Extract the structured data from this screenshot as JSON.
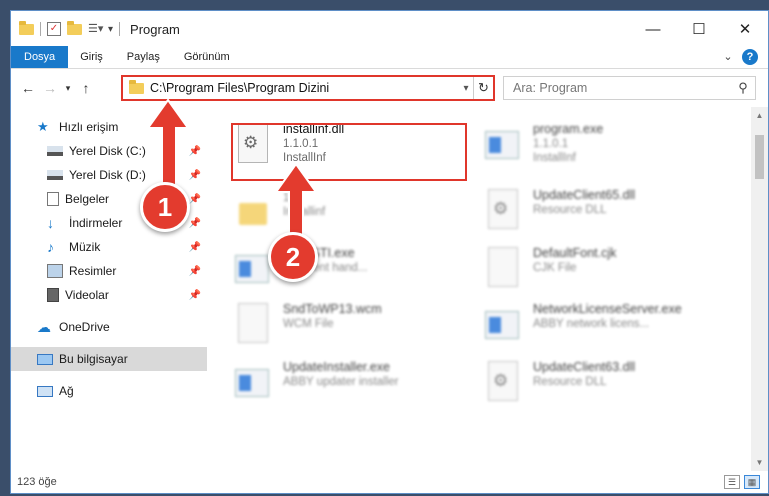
{
  "window": {
    "title": "Program"
  },
  "ribbon": {
    "tabs": [
      "Dosya",
      "Giriş",
      "Paylaş",
      "Görünüm"
    ]
  },
  "address": {
    "path": "C:\\Program Files\\Program Dizini"
  },
  "search": {
    "placeholder": "Ara: Program"
  },
  "sidebar": {
    "quick_access": "Hızlı erişim",
    "pinned": [
      {
        "label": "Yerel Disk (C:)",
        "icon": "drive-icon"
      },
      {
        "label": "Yerel Disk (D:)",
        "icon": "drive-icon"
      },
      {
        "label": "Belgeler",
        "icon": "documents-icon"
      },
      {
        "label": "İndirmeler",
        "icon": "downloads-icon"
      },
      {
        "label": "Müzik",
        "icon": "music-icon"
      },
      {
        "label": "Resimler",
        "icon": "pictures-icon"
      },
      {
        "label": "Videolar",
        "icon": "videos-icon"
      }
    ],
    "onedrive": "OneDrive",
    "this_pc": "Bu bilgisayar",
    "network": "Ağ"
  },
  "files": {
    "left": [
      {
        "name": "installinf.dll",
        "line2": "1.1.0.1",
        "line3": "InstallInf",
        "icon": "dll-icon"
      },
      {
        "name": "",
        "line2": "1.1",
        "line3": "Installinf",
        "icon": "folder-icon"
      },
      {
        "name": "AbbySTI.exe",
        "line2": "...ll event hand...",
        "line3": "",
        "icon": "app-icon"
      },
      {
        "name": "SndToWP13.wcm",
        "line2": "WCM File",
        "line3": "",
        "icon": "file-icon"
      },
      {
        "name": "UpdateInstaller.exe",
        "line2": "ABBY updater installer",
        "line3": "",
        "icon": "app-icon"
      }
    ],
    "right": [
      {
        "name": "program.exe",
        "line2": "1.1.0.1",
        "line3": "InstallInf",
        "icon": "app-icon"
      },
      {
        "name": "UpdateClient65.dll",
        "line2": "Resource DLL",
        "line3": "",
        "icon": "dll-icon"
      },
      {
        "name": "DefaultFont.cjk",
        "line2": "CJK File",
        "line3": "",
        "icon": "file-icon"
      },
      {
        "name": "NetworkLicenseServer.exe",
        "line2": "ABBY network licens...",
        "line3": "",
        "icon": "app-icon"
      },
      {
        "name": "UpdateClient63.dll",
        "line2": "Resource DLL",
        "line3": "",
        "icon": "dll-icon"
      }
    ]
  },
  "status": {
    "count": "123 öğe"
  },
  "annotations": {
    "step1": "1",
    "step2": "2",
    "color": "#e33b2e"
  }
}
